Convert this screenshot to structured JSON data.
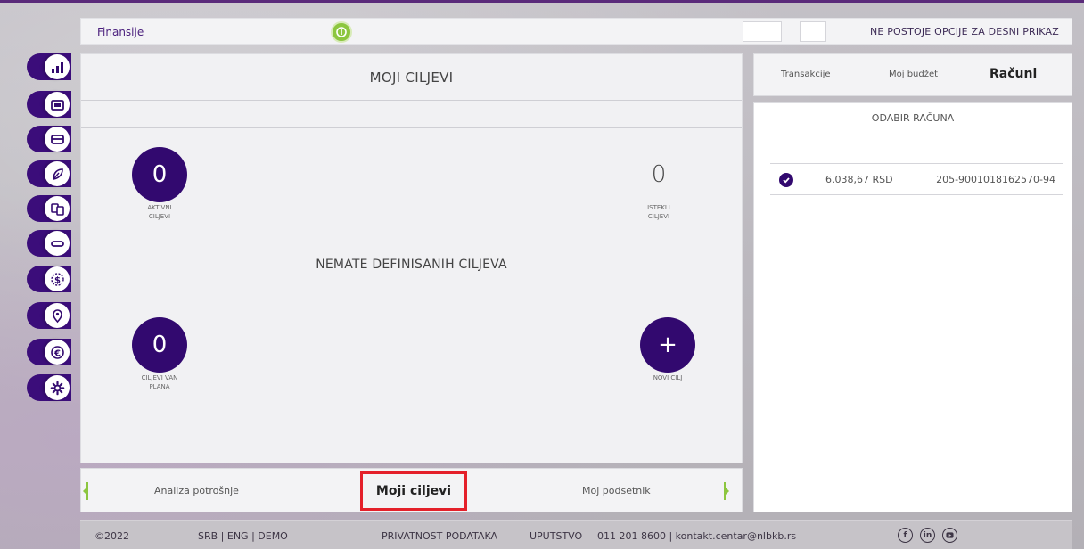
{
  "app": {
    "title": "Finansije",
    "right_panel_msg": "NE POSTOJE OPCIJE ZA DESNI PRIKAZ"
  },
  "sidebar": {
    "items": [
      {
        "icon": "bar-chart-icon"
      },
      {
        "icon": "briefcase-icon"
      },
      {
        "icon": "card-icon"
      },
      {
        "icon": "leaf-icon"
      },
      {
        "icon": "transfer-icon"
      },
      {
        "icon": "minus-icon"
      },
      {
        "icon": "dollar-icon"
      },
      {
        "icon": "location-icon"
      },
      {
        "icon": "euro-icon"
      },
      {
        "icon": "gear-icon"
      }
    ]
  },
  "main": {
    "title": "MOJI CILJEVI",
    "empty_message": "NEMATE DEFINISANIH CILJEVA",
    "goals": {
      "active": {
        "value": "0",
        "label_line1": "AKTIVNI",
        "label_line2": "CILJEVI"
      },
      "expired": {
        "value": "0",
        "label_line1": "ISTEKLI",
        "label_line2": "CILJEVI"
      },
      "unplanned": {
        "value": "0",
        "label_line1": "CILJEVI VAN",
        "label_line2": "PLANA"
      },
      "new": {
        "value": "+",
        "label_line1": "NOVI CILJ"
      }
    }
  },
  "tabs": {
    "items": [
      {
        "label": "Analiza potrošnje"
      },
      {
        "label": "Moji ciljevi"
      },
      {
        "label": "Moj podsetnik"
      }
    ]
  },
  "right_panel": {
    "tabs": [
      {
        "label": "Transakcije"
      },
      {
        "label": "Moj budžet"
      },
      {
        "label": "Računi"
      }
    ],
    "title": "ODABIR RAČUNA",
    "account": {
      "amount": "6.038,67 RSD",
      "number": "205-9001018162570-94"
    }
  },
  "footer": {
    "copyright": "©2022",
    "languages": "SRB  |  ENG  |  DEMO",
    "privacy": "PRIVATNOST PODATAKA",
    "help": "UPUTSTVO",
    "contact": "011 201 8600  |  kontakt.centar@nlbkb.rs",
    "social": [
      "facebook-icon",
      "linkedin-icon",
      "youtube-icon"
    ]
  },
  "colors": {
    "brand": "#32096f",
    "accent": "#8cc63f",
    "highlight": "#e4202a"
  }
}
